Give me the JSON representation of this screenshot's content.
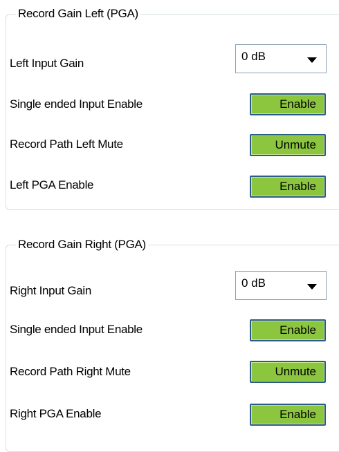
{
  "groups": [
    {
      "title": "Record Gain Left (PGA)",
      "gain_label": "Left Input Gain",
      "gain_value": "0 dB",
      "rows": [
        {
          "label": "Single ended Input Enable",
          "button": "Enable"
        },
        {
          "label": "Record Path Left Mute",
          "button": "Unmute"
        },
        {
          "label": "Left PGA Enable",
          "button": "Enable"
        }
      ]
    },
    {
      "title": "Record Gain Right (PGA)",
      "gain_label": "Right Input Gain",
      "gain_value": "0 dB",
      "rows": [
        {
          "label": "Single ended Input Enable",
          "button": "Enable"
        },
        {
          "label": "Record Path Right Mute",
          "button": "Unmute"
        },
        {
          "label": "Right PGA Enable",
          "button": "Enable"
        }
      ]
    }
  ],
  "colors": {
    "button_fill": "#8cc63f",
    "button_border": "#2c5d88",
    "group_border": "#d5dfe5"
  },
  "icons": {
    "dropdown": "triangle-down-icon"
  }
}
